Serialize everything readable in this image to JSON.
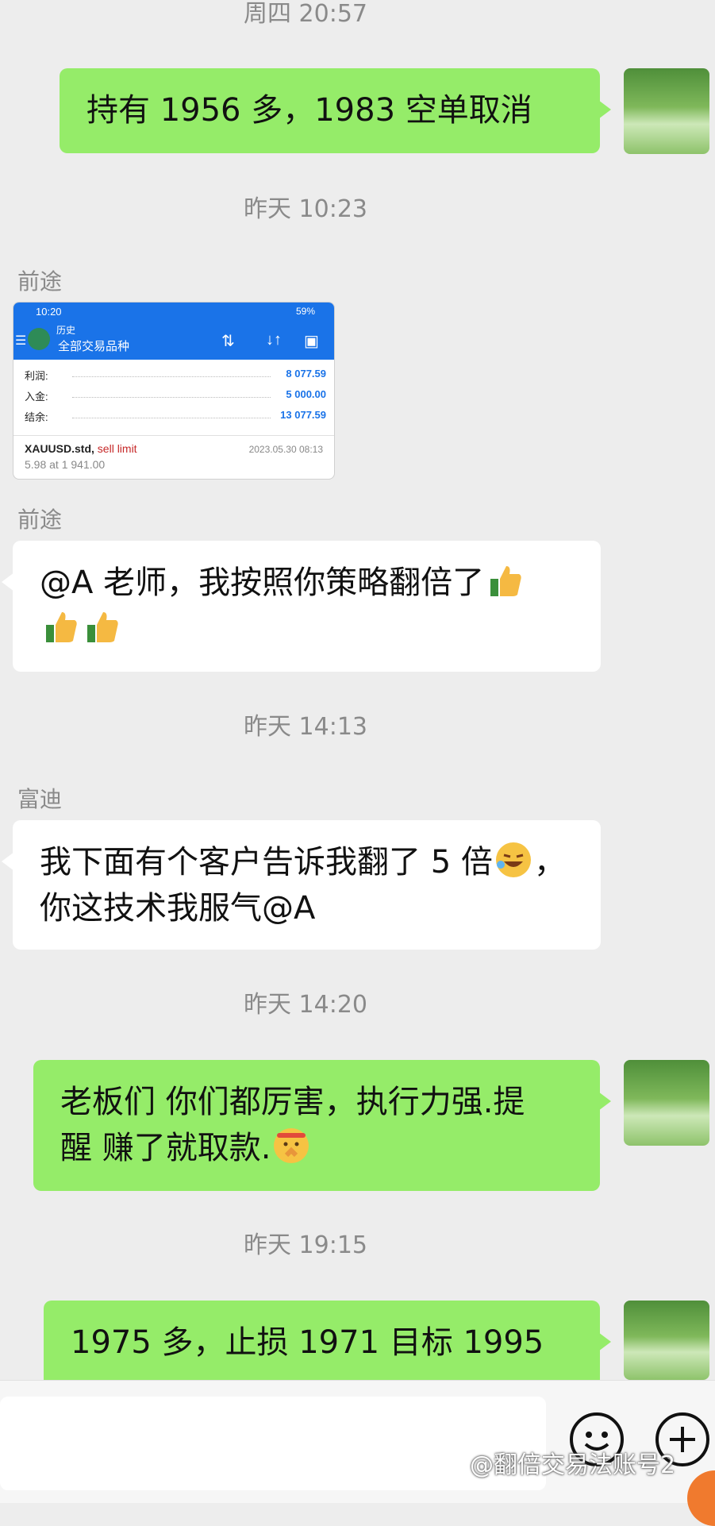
{
  "timestamps": [
    "周四 20:57",
    "昨天 10:23",
    "昨天 14:13",
    "昨天 14:20",
    "昨天 19:15"
  ],
  "messages": {
    "m1": "持有 1956 多，1983 空单取消",
    "m2_sender": "前途",
    "m3_sender": "前途",
    "m3_line1": "@A  老师，我按照你策略翻倍了",
    "m4_sender": "富迪",
    "m4_line1a": "我下面有个客户告诉我翻了 5 倍",
    "m4_line1b": "，",
    "m4_line2": "你这技术我服气@A",
    "m5_line1": "老板们  你们都厉害，执行力强.提",
    "m5_line2": "醒 赚了就取款.",
    "m6": "1975 多，止损 1971 目标 1995"
  },
  "screenshot": {
    "time": "10:20",
    "status_right": "59%",
    "history_label": "历史",
    "instrument_label": "全部交易品种",
    "rows": [
      {
        "label": "利润:",
        "value": "8 077.59"
      },
      {
        "label": "入金:",
        "value": "5 000.00"
      },
      {
        "label": "结余:",
        "value": "13 077.59"
      }
    ],
    "symbol": "XAUUSD.std,",
    "order_type": "sell limit",
    "date": "2023.05.30 08:13",
    "lot": "5.98 at 1 941.00"
  },
  "watermark": "@翻倍交易法账号2",
  "icons": [
    "avatar",
    "thumbs-up-icon",
    "laughing-emoji-icon",
    "shushing-emoji-icon",
    "emoji-button-icon",
    "plus-button-icon"
  ]
}
